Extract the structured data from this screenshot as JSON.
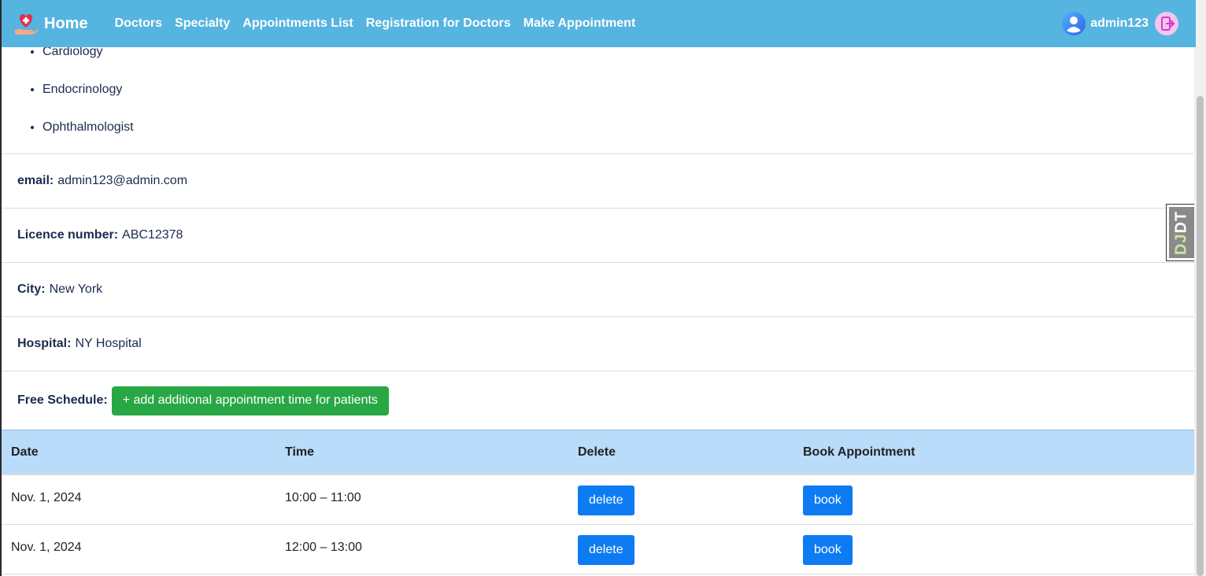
{
  "navbar": {
    "brand_label": "Home",
    "links": [
      "Doctors",
      "Specialty",
      "Appointments List",
      "Registration for Doctors",
      "Make Appointment"
    ],
    "username": "admin123"
  },
  "doctor": {
    "specialties": [
      "Cardiology",
      "Endocrinology",
      "Ophthalmologist"
    ],
    "email_label": "email:",
    "email": "admin123@admin.com",
    "licence_label": "Licence number:",
    "licence": "ABC12378",
    "city_label": "City:",
    "city": "New York",
    "hospital_label": "Hospital:",
    "hospital": "NY Hospital",
    "schedule_label": "Free Schedule:",
    "add_button": "+ add additional appointment time for patients"
  },
  "table": {
    "headers": [
      "Date",
      "Time",
      "Delete",
      "Book Appointment"
    ],
    "rows": [
      {
        "date": "Nov. 1, 2024",
        "time": "10:00 – 11:00",
        "delete": "delete",
        "book": "book"
      },
      {
        "date": "Nov. 1, 2024",
        "time": "12:00 – 13:00",
        "delete": "delete",
        "book": "book"
      }
    ]
  },
  "debug_toolbar": {
    "label_a": "DJ",
    "label_b": "DT"
  },
  "colors": {
    "navbar": "#55b4e0",
    "table_header": "#b9dcfb",
    "green_button": "#28a745",
    "blue_button": "#0d7cf2"
  }
}
